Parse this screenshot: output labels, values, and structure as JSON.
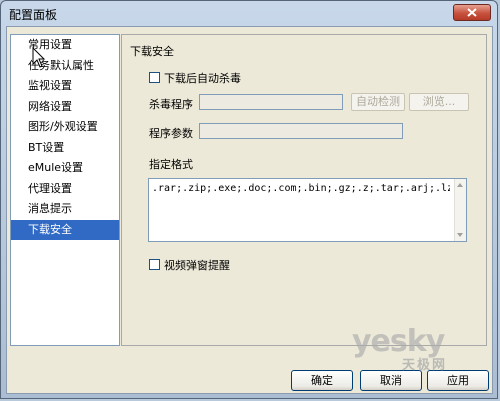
{
  "window": {
    "title": "配置面板"
  },
  "sidebar": {
    "items": [
      {
        "label": "常用设置"
      },
      {
        "label": "任务默认属性"
      },
      {
        "label": "监视设置"
      },
      {
        "label": "网络设置"
      },
      {
        "label": "图形/外观设置"
      },
      {
        "label": "BT设置"
      },
      {
        "label": "eMule设置"
      },
      {
        "label": "代理设置"
      },
      {
        "label": "消息提示"
      },
      {
        "label": "下载安全"
      }
    ],
    "selected": "下载安全"
  },
  "panel": {
    "section_title": "下载安全",
    "auto_scan_label": "下载后自动杀毒",
    "auto_scan_checked": false,
    "antivirus_label": "杀毒程序",
    "antivirus_value": "",
    "auto_detect_label": "自动检测",
    "browse_label": "浏览...",
    "params_label": "程序参数",
    "params_value": "",
    "formats_label": "指定格式",
    "formats_value": ".rar;.zip;.exe;.doc;.com;.bin;.gz;.z;.tar;.arj;.lzh;.",
    "popup_label": "视频弹窗提醒",
    "popup_checked": false
  },
  "footer": {
    "ok_label": "确定",
    "cancel_label": "取消",
    "apply_label": "应用"
  },
  "watermark": {
    "main": "yesky",
    "sub": "天极网"
  }
}
